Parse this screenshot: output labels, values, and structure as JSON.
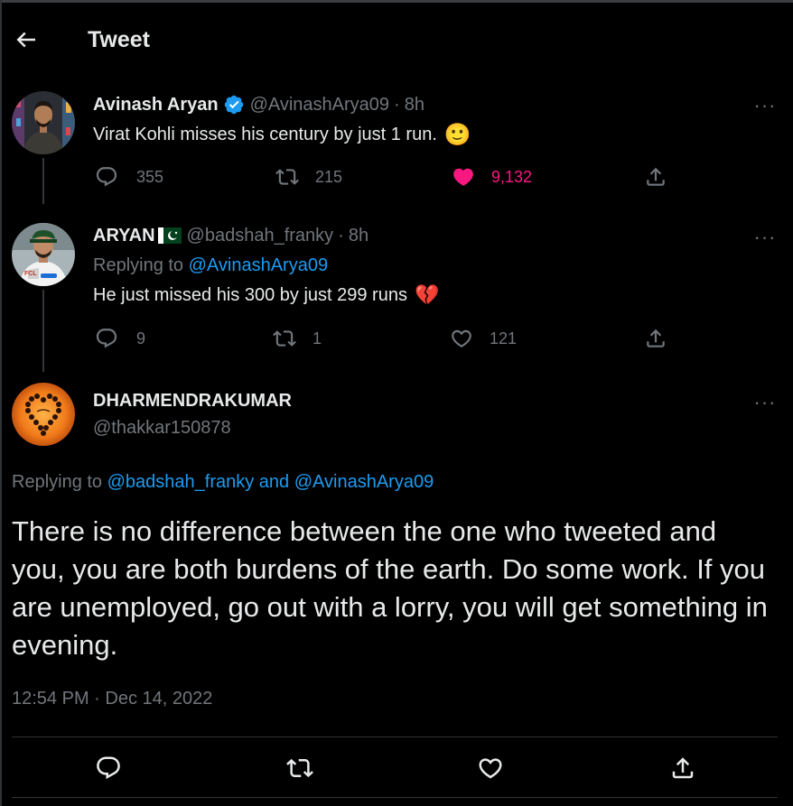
{
  "header": {
    "title": "Tweet"
  },
  "tweets": [
    {
      "name": "Avinash Aryan",
      "handle": "@AvinashArya09",
      "time": "8h",
      "text": "Virat Kohli misses his century by just 1 run.",
      "emoji": "🙂",
      "replies": "355",
      "retweets": "215",
      "likes": "9,132",
      "liked": true
    },
    {
      "name": "ARYAN",
      "flag": "🇵🇰",
      "handle": "@badshah_franky",
      "time": "8h",
      "replying_label": "Replying to",
      "replying_to": "@AvinashArya09",
      "text": "He just missed his 300 by just 299 runs",
      "emoji": "💔",
      "replies": "9",
      "retweets": "1",
      "likes": "121"
    }
  ],
  "main_tweet": {
    "name": "DHARMENDRAKUMAR",
    "handle": "@thakkar150878",
    "replying_label": "Replying to",
    "replying_to": "@badshah_franky and @AvinashArya09",
    "text": "There is no difference between the one who tweeted and you, you are both burdens of the earth. Do some work. If you are unemployed, go out with a lorry, you will get something in evening.",
    "date": "12:54 PM · Dec 14, 2022"
  },
  "colors": {
    "accent": "#1d9bf0",
    "like": "#f91880",
    "muted": "#71767b",
    "background": "#000000"
  },
  "icons": {
    "back": "arrow-left-icon",
    "reply": "reply-icon",
    "retweet": "retweet-icon",
    "like": "heart-icon",
    "share": "share-icon",
    "more": "more-icon",
    "verified": "verified-icon"
  }
}
